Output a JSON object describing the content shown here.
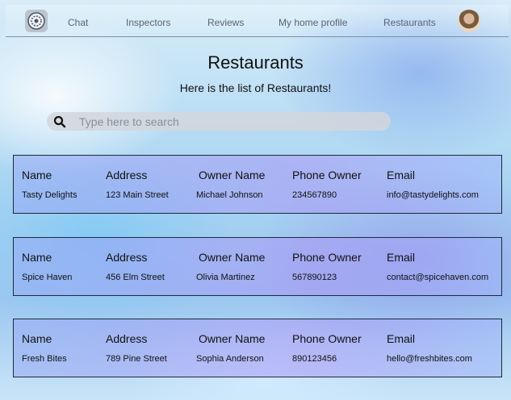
{
  "nav": {
    "links": [
      "Chat",
      "Inspectors",
      "Reviews",
      "My home profile",
      "Restaurants"
    ]
  },
  "page": {
    "title": "Restaurants",
    "subtitle": "Here is the list of Restaurants!"
  },
  "search": {
    "placeholder": "Type here to search"
  },
  "columns": [
    "Name",
    "Address",
    "Owner Name",
    "Phone Owner",
    "Email"
  ],
  "restaurants": [
    {
      "name": "Tasty Delights",
      "address": "123 Main Street",
      "owner": "Michael Johnson",
      "phone": "234567890",
      "email": "info@tastydelights.com"
    },
    {
      "name": "Spice Haven",
      "address": "456 Elm Street",
      "owner": "Olivia Martinez",
      "phone": "567890123",
      "email": "contact@spicehaven.com"
    },
    {
      "name": "Fresh Bites",
      "address": "789 Pine Street",
      "owner": "Sophia Anderson",
      "phone": "890123456",
      "email": "hello@freshbites.com"
    }
  ]
}
